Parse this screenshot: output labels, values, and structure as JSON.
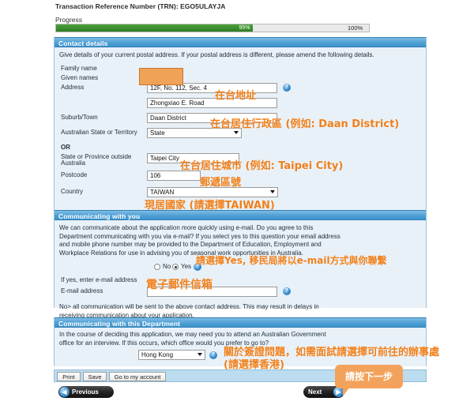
{
  "header": {
    "trn_line": "Transaction Reference Number (TRN): EGO5ULAYJA",
    "progress_label": "Progress",
    "progress_value": "95%",
    "progress_end": "100%",
    "progress_percent": 63
  },
  "contact_section": {
    "title": "Contact details",
    "blurb": "Give details of your current postal address. If your postal address is different, please amend the following details.",
    "fields": {
      "family_name_label": "Family name",
      "given_names_label": "Given names",
      "address_label": "Address",
      "address_line1": "12F, No. 112, Sec. 4",
      "address_line2": "Zhongxiao E. Road",
      "suburb_label": "Suburb/Town",
      "suburb_value": "Daan District",
      "state_au_label": "Australian State or Territory",
      "state_au_value": "State",
      "or_label": "OR",
      "state_outside_label": "State or Province outside Australia",
      "state_outside_value": "Taipei City",
      "postcode_label": "Postcode",
      "postcode_value": "106",
      "country_label": "Country",
      "country_value": "TAIWAN"
    }
  },
  "communicating_with_you": {
    "title": "Communicating with you",
    "blurb": "We can communicate about the application more quickly using e-mail. Do you agree to this Department communicating with you via e-mail? If you select yes to this question your email address and mobile phone number may be provided to the Department of Education, Employment and Workplace Relations for use in advising you of seasonal work opportunities in Australia.",
    "radio_no": "No",
    "radio_yes": "Yes",
    "selected": "Yes",
    "if_yes_label": "If yes, enter e-mail address",
    "email_label": "E-mail address",
    "email_value": "",
    "note": "No> all communication will be sent to the above contact address. This may result in delays in receiving communication about your application."
  },
  "communicating_with_department": {
    "title": "Communicating with this Department",
    "blurb": "In the course of deciding this application, we may need you to attend an Australian Government office for an interview. If this occurs, which office would you prefer to go to?",
    "office_value": "Hong Kong"
  },
  "toolbar": {
    "print_label": "Print",
    "save_label": "Save",
    "account_label": "Go to my account",
    "previous_label": "Previous",
    "next_label": "Next"
  },
  "annotations": {
    "address": "在台地址",
    "suburb": "在台居住行政區 (例如: Daan District)",
    "city": "在台居住城市 (例如: Taipei City)",
    "postcode": "郵遞區號",
    "country": "現居國家 (請選擇TAIWAN)",
    "email_yes": "請選擇Yes, 移民局將以e-mail方式與你聯繫",
    "email_box": "電子郵件信箱",
    "office_line1": "關於簽證問題，如需面試請選擇可前往的辦事處",
    "office_line2": "(請選擇香港)",
    "next_callout": "請按下一步"
  },
  "colors": {
    "accent_orange": "#f07f1a",
    "section_blue": "#3d93cd",
    "progress_green": "#3d9130",
    "panel_bg": "#e9f1f8",
    "callout": "#f3a25b"
  }
}
